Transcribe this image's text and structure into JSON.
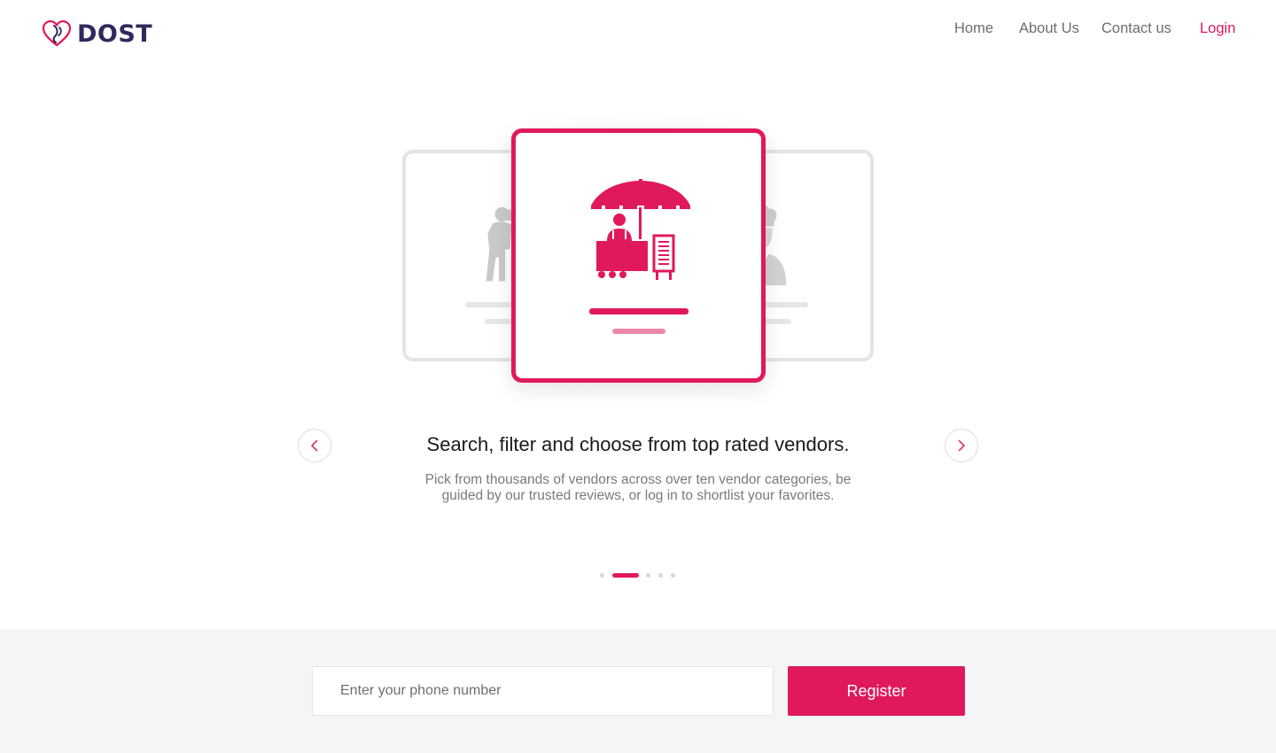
{
  "brand": {
    "name": "DOST",
    "accent": "#e0195b",
    "logo_color": "#2e2a5e"
  },
  "nav": {
    "items": [
      {
        "label": "Home"
      },
      {
        "label": "About Us"
      },
      {
        "label": "Contact us"
      },
      {
        "label": "Login"
      }
    ]
  },
  "carousel": {
    "illustration": {
      "left_card_icon": "photographer-icon",
      "center_card_icon": "food-stall-vendor-icon",
      "right_card_icon": "chef-icon"
    },
    "slide": {
      "title": "Search, filter and choose from top rated vendors.",
      "description": "Pick from thousands of vendors across over ten vendor categories, be guided by our trusted reviews, or log in to shortlist your favorites."
    },
    "prev_icon": "chevron-left-icon",
    "next_icon": "chevron-right-icon",
    "dots_total": 5,
    "active_dot": 2
  },
  "register": {
    "phone_placeholder": "Enter your phone number",
    "button_label": "Register"
  }
}
